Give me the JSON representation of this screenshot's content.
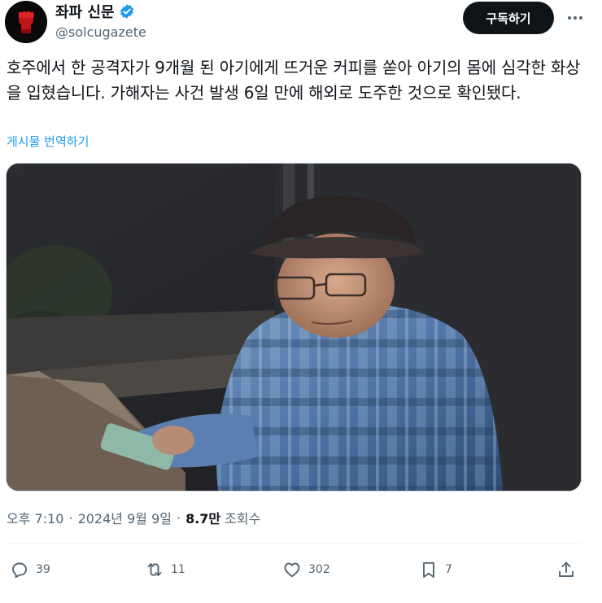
{
  "author": {
    "display_name": "좌파 신문",
    "handle": "@solcugazete",
    "avatar_icon": "raised-fist-avatar",
    "verified_color": "#1d9bf0"
  },
  "header": {
    "subscribe_label": "구독하기",
    "more_icon": "more-options-icon"
  },
  "tweet": {
    "text": "호주에서 한 공격자가 9개월 된 아기에게 뜨거운 커피를 쏟아 아기의 몸에 심각한 화상을 입혔습니다. 가해자는 사건 발생 6일 만에 해외로 도주한 것으로 확인됐다.",
    "translate_label": "게시물 번역하기"
  },
  "media": {
    "description_icon": "surveillance-photo"
  },
  "meta": {
    "time": "오후 7:10",
    "separator": "·",
    "date": "2024년 9월 9일",
    "views_count": "8.7만",
    "views_label": "조회수"
  },
  "actions": {
    "replies": "39",
    "reposts": "11",
    "likes": "302",
    "bookmarks": "7"
  },
  "colors": {
    "text_primary": "#0f1419",
    "text_secondary": "#536471",
    "link": "#1d9bf0",
    "button_bg": "#0f1419"
  }
}
